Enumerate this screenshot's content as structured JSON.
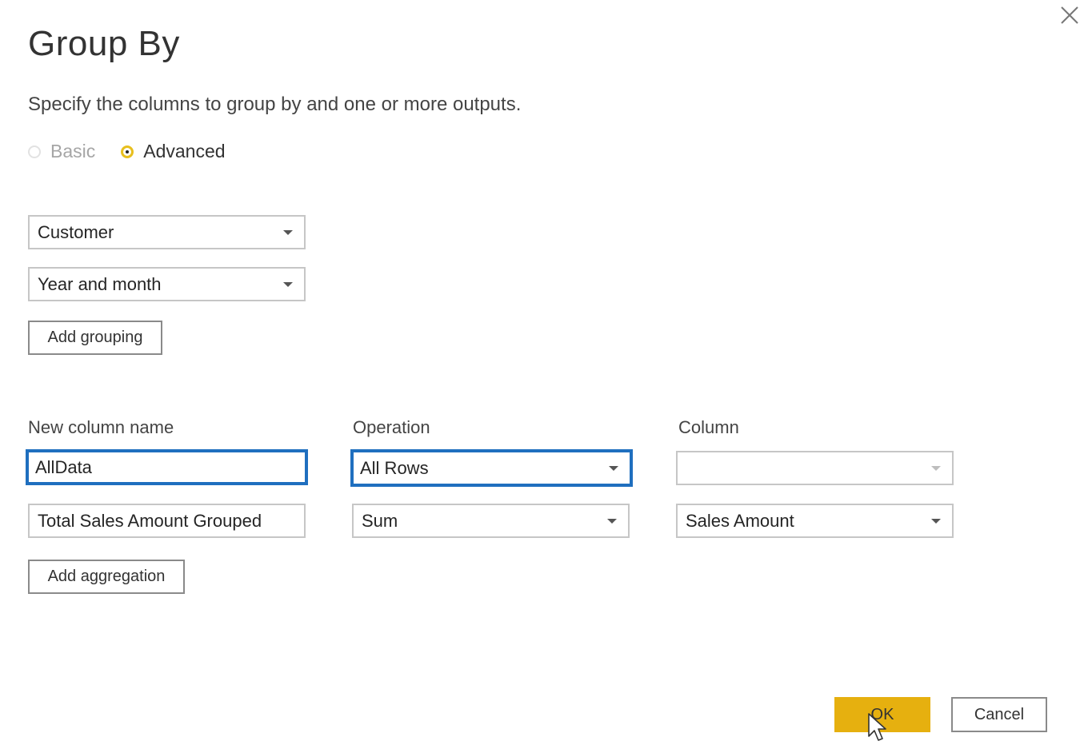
{
  "dialog": {
    "title": "Group By",
    "subtitle": "Specify the columns to group by and one or more outputs.",
    "close_icon": "close-icon"
  },
  "mode": {
    "options": [
      {
        "label": "Basic",
        "selected": false,
        "enabled": false
      },
      {
        "label": "Advanced",
        "selected": true,
        "enabled": true
      }
    ],
    "accent_color": "#e8bf1e"
  },
  "grouping": {
    "columns": [
      "Customer",
      "Year and month"
    ],
    "add_label": "Add grouping"
  },
  "aggregations": {
    "headers": {
      "new_column_name": "New column name",
      "operation": "Operation",
      "column": "Column"
    },
    "rows": [
      {
        "name": "AllData",
        "operation": "All Rows",
        "column": ""
      },
      {
        "name": "Total Sales Amount Grouped",
        "operation": "Sum",
        "column": "Sales Amount"
      }
    ],
    "add_label": "Add aggregation",
    "focus_color": "#1f6fbf"
  },
  "footer": {
    "ok_label": "OK",
    "cancel_label": "Cancel",
    "ok_color": "#e6b00f"
  }
}
